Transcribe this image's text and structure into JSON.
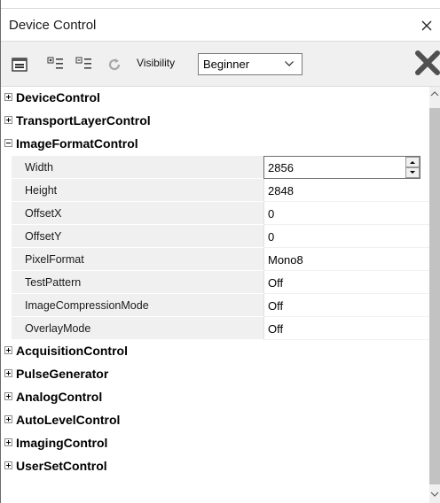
{
  "window": {
    "title": "Device Control",
    "close_icon": "close-icon"
  },
  "toolbar": {
    "icons": [
      "property-page-icon",
      "expand-all-icon",
      "collapse-all-icon",
      "refresh-icon"
    ],
    "visibility_label": "Visibility",
    "visibility_value": "Beginner",
    "clear_icon": "large-x-icon"
  },
  "categories_top": [
    {
      "label": "DeviceControl",
      "expanded": false
    },
    {
      "label": "TransportLayerControl",
      "expanded": false
    },
    {
      "label": "ImageFormatControl",
      "expanded": true
    }
  ],
  "properties": [
    {
      "label": "Width",
      "value": "2856"
    },
    {
      "label": "Height",
      "value": "2848"
    },
    {
      "label": "OffsetX",
      "value": "0"
    },
    {
      "label": "OffsetY",
      "value": "0"
    },
    {
      "label": "PixelFormat",
      "value": "Mono8"
    },
    {
      "label": "TestPattern",
      "value": "Off"
    },
    {
      "label": "ImageCompressionMode",
      "value": "Off"
    },
    {
      "label": "OverlayMode",
      "value": "Off"
    }
  ],
  "categories_bottom": [
    {
      "label": "AcquisitionControl",
      "expanded": false
    },
    {
      "label": "PulseGenerator",
      "expanded": false
    },
    {
      "label": "AnalogControl",
      "expanded": false
    },
    {
      "label": "AutoLevelControl",
      "expanded": false
    },
    {
      "label": "ImagingControl",
      "expanded": false
    },
    {
      "label": "UserSetControl",
      "expanded": false
    }
  ],
  "colors": {
    "label_cell_bg": "#f0f0f0",
    "scroll_thumb": "#c2c2c2"
  }
}
